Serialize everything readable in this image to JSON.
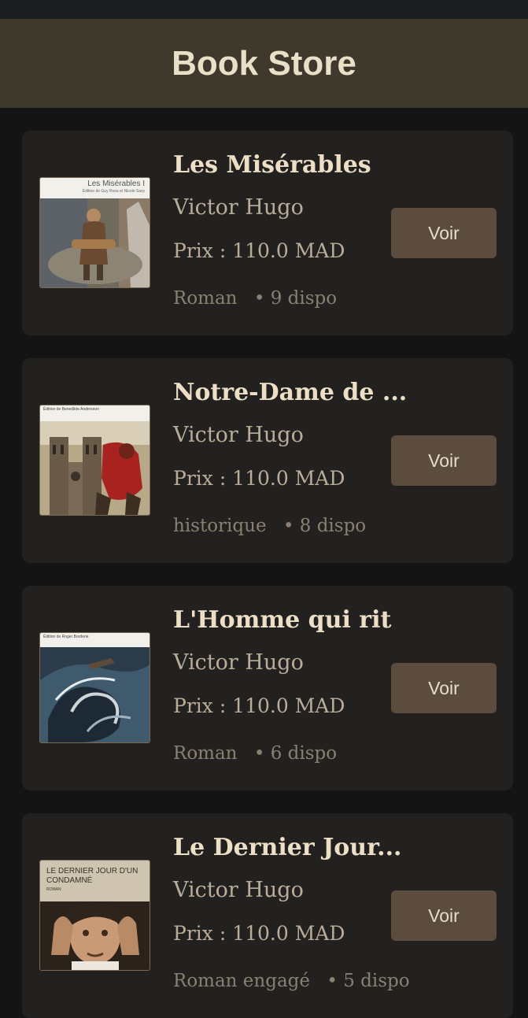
{
  "app": {
    "title": "Book Store"
  },
  "colors": {
    "app_bar": "#3e382d",
    "background": "#141414",
    "card": "#232120",
    "button": "#5c4c3d",
    "title_text": "#ecdfc6"
  },
  "books": [
    {
      "title": "Les Misérables",
      "author": "Victor Hugo",
      "price": "Prix : 110.0 MAD",
      "genre": "Roman",
      "stock": "• 9 dispo",
      "button": "Voir",
      "cover_text": "Les Misérables I",
      "cover_subtext": "Édition de Guy Rosa et Nicole Savy"
    },
    {
      "title": "Notre-Dame de ...",
      "author": "Victor Hugo",
      "price": "Prix : 110.0 MAD",
      "genre": "historique",
      "stock": "• 8 dispo",
      "button": "Voir",
      "cover_text": "Édition de Benedikte Andersson"
    },
    {
      "title": "L'Homme qui rit",
      "author": "Victor Hugo",
      "price": "Prix : 110.0 MAD",
      "genre": "Roman",
      "stock": "• 6 dispo",
      "button": "Voir",
      "cover_text": "Édition de Roger Borderie"
    },
    {
      "title": "Le Dernier Jour...",
      "author": "Victor Hugo",
      "price": "Prix : 110.0 MAD",
      "genre": "Roman engagé",
      "stock": "• 5 dispo",
      "button": "Voir",
      "cover_text": "LE DERNIER JOUR D'UN CONDAMNÉ",
      "cover_subtext": "ROMAN"
    }
  ]
}
